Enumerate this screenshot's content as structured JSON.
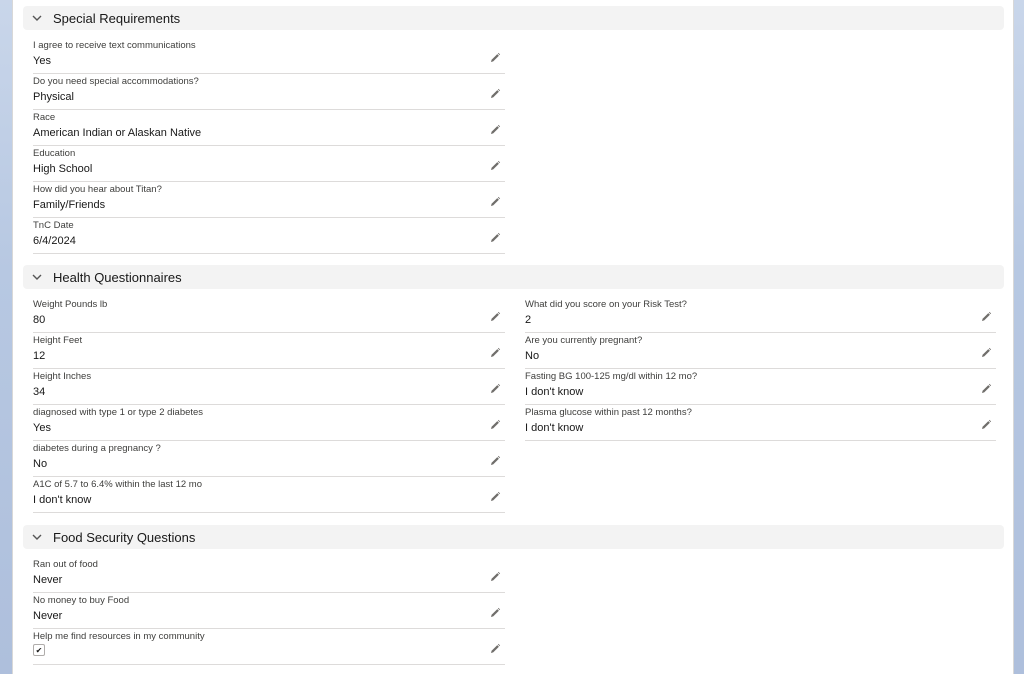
{
  "sections": [
    {
      "title": "Special Requirements",
      "left": [
        {
          "label": "I agree to receive text communications",
          "value": "Yes"
        },
        {
          "label": "Do you need special accommodations?",
          "value": "Physical"
        },
        {
          "label": "Race",
          "value": "American Indian or Alaskan Native"
        },
        {
          "label": "Education",
          "value": "High School"
        },
        {
          "label": "How did you hear about Titan?",
          "value": "Family/Friends"
        },
        {
          "label": "TnC Date",
          "value": "6/4/2024"
        }
      ]
    },
    {
      "title": "Health Questionnaires",
      "left": [
        {
          "label": "Weight Pounds lb",
          "value": "80"
        },
        {
          "label": "Height Feet",
          "value": "12"
        },
        {
          "label": "Height Inches",
          "value": "34"
        },
        {
          "label": "diagnosed with type 1 or type 2 diabetes",
          "value": "Yes"
        },
        {
          "label": "diabetes during a pregnancy ?",
          "value": "No"
        },
        {
          "label": "A1C of 5.7 to 6.4% within the last 12 mo",
          "value": "I don't know"
        }
      ],
      "right": [
        {
          "label": "What did you score on your Risk Test?",
          "value": "2"
        },
        {
          "label": "Are you currently pregnant?",
          "value": "No"
        },
        {
          "label": "Fasting BG 100-125 mg/dl within 12 mo?",
          "value": "I don't know"
        },
        {
          "label": "Plasma glucose within past 12 months?",
          "value": "I don't know"
        }
      ]
    },
    {
      "title": "Food Security Questions",
      "left": [
        {
          "label": "Ran out of food",
          "value": "Never"
        },
        {
          "label": "No money to buy Food",
          "value": "Never"
        },
        {
          "label": "Help me find resources in my community",
          "checked": true
        }
      ]
    }
  ],
  "icons": {
    "collapse": "chevron-down-icon",
    "edit": "pencil-icon",
    "check": "checkmark-icon"
  }
}
